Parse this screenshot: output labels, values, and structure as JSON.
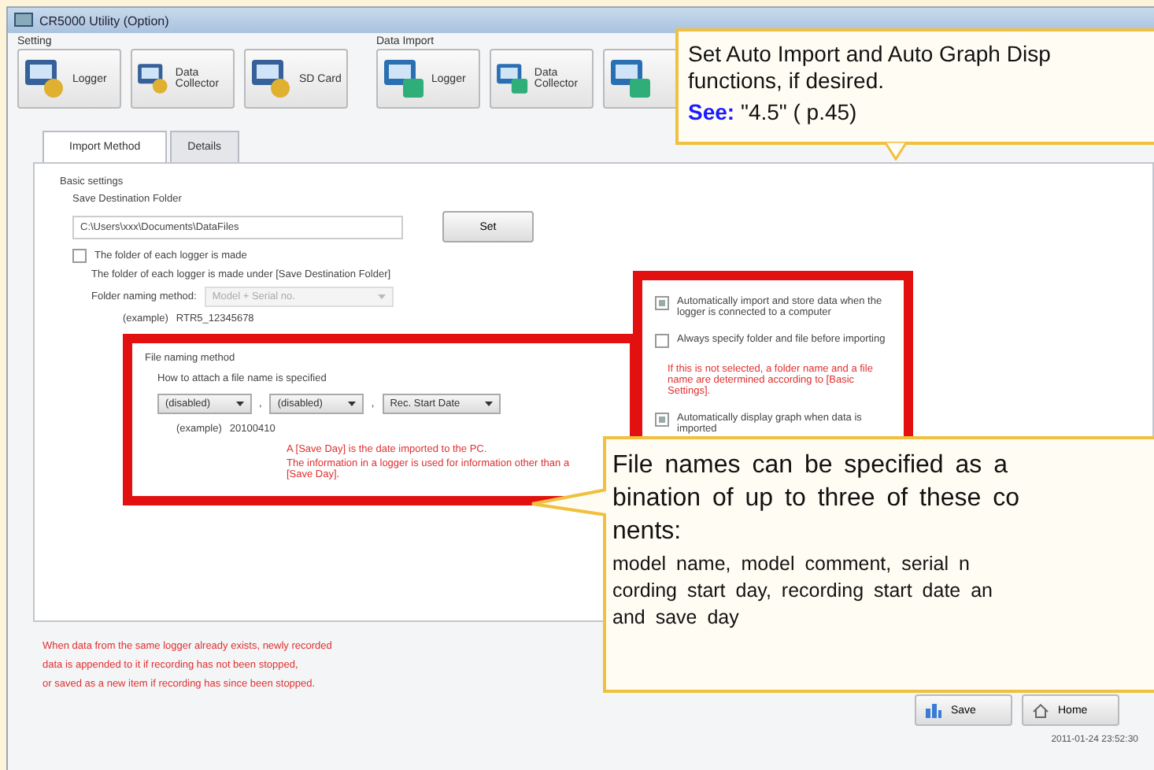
{
  "window": {
    "title": "CR5000 Utility (Option)"
  },
  "toolbar_groups": [
    {
      "label": "Setting",
      "buttons": [
        {
          "label": "Logger",
          "kind": "setting"
        },
        {
          "label": "Data Collector",
          "kind": "setting"
        },
        {
          "label": "SD Card",
          "kind": "setting"
        }
      ]
    },
    {
      "label": "Data Import",
      "buttons": [
        {
          "label": "Logger",
          "kind": "import"
        },
        {
          "label": "Data Collector",
          "kind": "import"
        },
        {
          "kind": "import"
        }
      ]
    }
  ],
  "tabs": [
    {
      "label": "Import Method",
      "selected": true
    },
    {
      "label": "Details",
      "selected": false
    }
  ],
  "basic_settings": {
    "heading": "Basic settings",
    "folder_label": "Save Destination Folder",
    "folder_value": "C:\\Users\\xxx\\Documents\\DataFiles",
    "set_button": "Set",
    "logger_folder": {
      "label": "The folder of each logger is made",
      "checked": false
    },
    "logger_folder_note": "The folder of each logger is made under [Save Destination Folder]",
    "folder_naming_label": "Folder naming method:",
    "folder_naming_value": "Model + Serial no.",
    "folder_example_label": "(example)",
    "folder_example": "RTR5_12345678"
  },
  "file_naming": {
    "heading": "File naming method",
    "label": "How to attach a file name is specified",
    "dropdowns": [
      "(disabled)",
      "(disabled)",
      "Rec. Start Date"
    ],
    "separators": [
      ",",
      ","
    ],
    "example_label": "(example)",
    "example": "20100410",
    "notes": [
      "A [Save Day] is the date imported to the PC.",
      "The information in a logger is used for information other than a [Save Day]."
    ]
  },
  "auto_options": [
    {
      "kind": "checkbox",
      "label": "Automatically import and store data when the logger is connected to a computer",
      "checked": true
    },
    {
      "kind": "checkbox",
      "label": "Always specify folder and file before importing",
      "checked": false
    },
    {
      "kind": "note",
      "label": "If this is not selected, a folder name and a file name are determined according to [Basic Settings]."
    },
    {
      "kind": "checkbox",
      "label": "Automatically display graph when data is imported",
      "checked": true
    }
  ],
  "footer_notes": [
    "When data from the same logger already exists, newly recorded",
    "data is appended to it if recording has not been stopped,",
    "or saved as a new item if recording has since been stopped."
  ],
  "bottom_buttons": [
    {
      "label": "Save",
      "kind": "save"
    },
    {
      "label": "Home",
      "kind": "home"
    }
  ],
  "status_bar": "2011-01-24 23:52:30",
  "callouts": [
    {
      "lines": [
        "Set Auto Import and Auto Graph Disp",
        "functions, if desired."
      ],
      "see_label": "See:",
      "see_ref": "\"4.5\" ( p.45)"
    },
    {
      "lines": [
        "File names can be specified as a",
        "bination of up to three of these co",
        "nents:"
      ],
      "detail_lines": [
        "model name, model comment, serial n",
        "cording start day, recording start date an",
        "and save day"
      ]
    }
  ]
}
